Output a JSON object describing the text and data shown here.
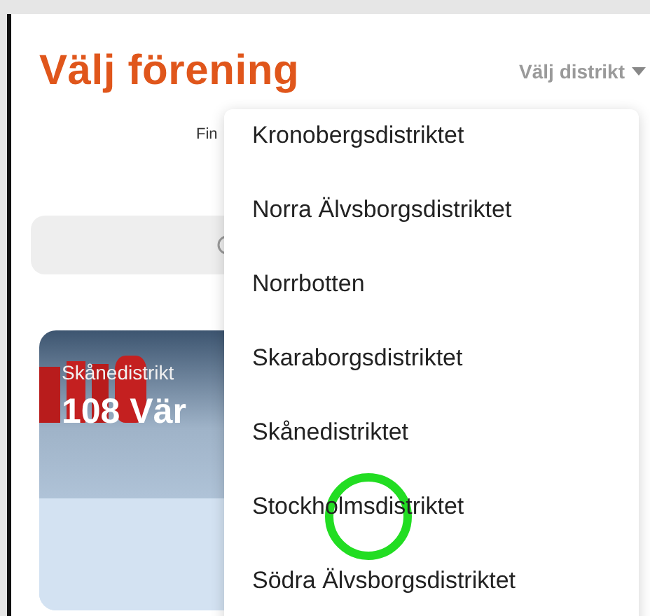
{
  "header": {
    "title": "Välj förening",
    "district_picker": {
      "label": "Välj distrikt"
    }
  },
  "intro": "Fin",
  "card": {
    "district": "Skånedistrikt",
    "title": "108 Vär"
  },
  "dropdown": {
    "items": [
      {
        "label": "Kronobergsdistriktet"
      },
      {
        "label": "Norra Älvsborgsdistriktet"
      },
      {
        "label": "Norrbotten"
      },
      {
        "label": "Skaraborgsdistriktet"
      },
      {
        "label": "Skånedistriktet"
      },
      {
        "label": "Stockholmsdistriktet"
      },
      {
        "label": "Södra Älvsborgsdistriktet"
      }
    ]
  }
}
